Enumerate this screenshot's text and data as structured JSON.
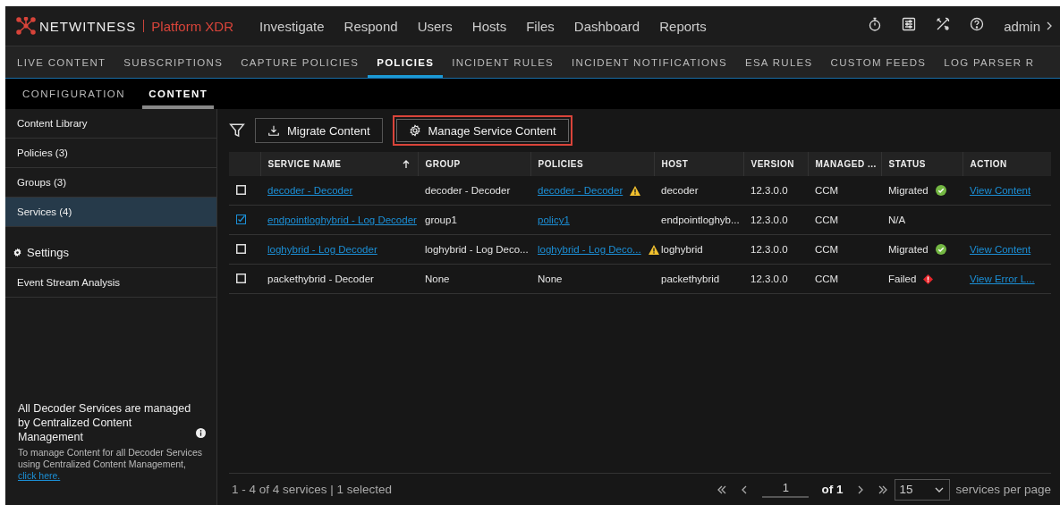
{
  "brand": {
    "name": "NETWITNESS",
    "product": "Platform XDR"
  },
  "nav": [
    {
      "label": "Investigate"
    },
    {
      "label": "Respond"
    },
    {
      "label": "Users"
    },
    {
      "label": "Hosts"
    },
    {
      "label": "Files"
    },
    {
      "label": "Dashboard"
    },
    {
      "label": "Reports"
    }
  ],
  "user": "admin",
  "tabs": [
    {
      "label": "LIVE CONTENT",
      "selected": false
    },
    {
      "label": "SUBSCRIPTIONS",
      "selected": false
    },
    {
      "label": "CAPTURE POLICIES",
      "selected": false
    },
    {
      "label": "POLICIES",
      "selected": true
    },
    {
      "label": "INCIDENT RULES",
      "selected": false
    },
    {
      "label": "INCIDENT NOTIFICATIONS",
      "selected": false
    },
    {
      "label": "ESA RULES",
      "selected": false
    },
    {
      "label": "CUSTOM FEEDS",
      "selected": false
    },
    {
      "label": "LOG PARSER R",
      "selected": false
    }
  ],
  "subtabs": [
    {
      "label": "CONFIGURATION",
      "selected": false
    },
    {
      "label": "CONTENT",
      "selected": true
    }
  ],
  "sidebar": {
    "items": [
      {
        "kind": "item",
        "label": "Content Library",
        "selected": false
      },
      {
        "kind": "item",
        "label": "Policies (3)",
        "selected": false
      },
      {
        "kind": "item",
        "label": "Groups (3)",
        "selected": false
      },
      {
        "kind": "item",
        "label": "Services (4)",
        "selected": true
      },
      {
        "kind": "header",
        "label": "Settings"
      },
      {
        "kind": "item",
        "label": "Event Stream Analysis",
        "selected": false
      }
    ],
    "note": {
      "title": "All Decoder Services are managed by Centralized Content Management",
      "body": "To manage Content for all Decoder Services using Centralized Content Management,",
      "link": "click here."
    }
  },
  "toolbar": {
    "buttons": [
      {
        "kind": "download",
        "label": "Migrate Content",
        "highlighted": false
      },
      {
        "kind": "gear",
        "label": "Manage Service Content",
        "highlighted": true
      }
    ]
  },
  "table": {
    "columns": [
      "SERVICE NAME",
      "GROUP",
      "POLICIES",
      "HOST",
      "VERSION",
      "MANAGED ...",
      "STATUS",
      "ACTION"
    ],
    "rows": [
      {
        "checked": false,
        "service": {
          "text": "decoder - Decoder",
          "link": true
        },
        "group": "decoder - Decoder",
        "policies": {
          "text": "decoder - Decoder",
          "link": true,
          "warning": true
        },
        "host": "decoder",
        "version": "12.3.0.0",
        "managed": "CCM",
        "status": {
          "text": "Migrated",
          "kind": "ok"
        },
        "action": "View Content"
      },
      {
        "checked": true,
        "service": {
          "text": "endpointloghybrid - Log Decoder",
          "link": true
        },
        "group": "group1",
        "policies": {
          "text": "policy1",
          "link": true,
          "warning": false
        },
        "host": "endpointloghyb...",
        "version": "12.3.0.0",
        "managed": "CCM",
        "status": {
          "text": "N/A",
          "kind": "none"
        }
      },
      {
        "checked": false,
        "service": {
          "text": "loghybrid - Log Decoder",
          "link": true
        },
        "group": "loghybrid - Log Deco...",
        "policies": {
          "text": "loghybrid - Log Deco...",
          "link": true,
          "warning": true
        },
        "host": "loghybrid",
        "version": "12.3.0.0",
        "managed": "CCM",
        "status": {
          "text": "Migrated",
          "kind": "ok"
        },
        "action": "View Content"
      },
      {
        "checked": false,
        "service": {
          "text": "packethybrid - Decoder",
          "link": false
        },
        "group": "None",
        "policies": {
          "text": "None",
          "link": false,
          "warning": false
        },
        "host": "packethybrid",
        "version": "12.3.0.0",
        "managed": "CCM",
        "status": {
          "text": "Failed",
          "kind": "error"
        },
        "action": "View Error L..."
      }
    ]
  },
  "footer": {
    "summary": "1 - 4 of 4 services | 1 selected",
    "page": "1",
    "of": "of",
    "total": "1",
    "per_page": "15",
    "per_page_label": "services per page"
  }
}
